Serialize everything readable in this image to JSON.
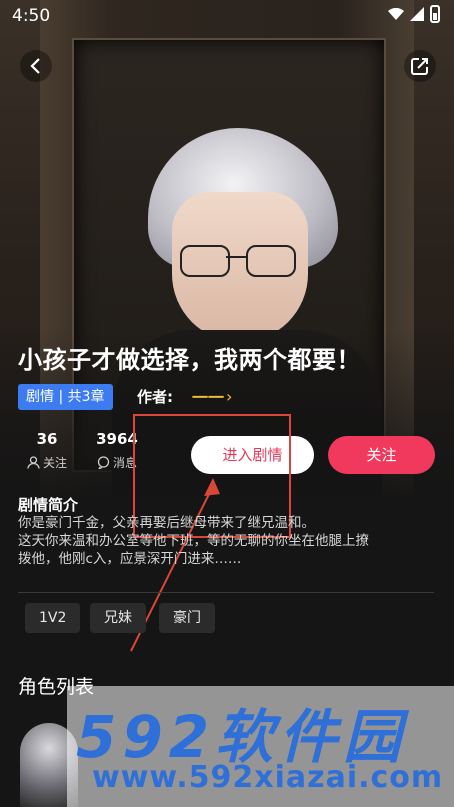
{
  "status_bar": {
    "time": "4:50"
  },
  "novel": {
    "title": "小孩子才做选择，我两个都要！",
    "tag": "剧情 | 共3章",
    "author_label": "作者:",
    "author_name": "一一",
    "author_chevron": "›"
  },
  "stats": [
    {
      "value": "36",
      "label": "关注"
    },
    {
      "value": "3964",
      "label": "消息"
    }
  ],
  "actions": {
    "enter_label": "进入剧情",
    "follow_label": "关注"
  },
  "intro": {
    "title": "剧情简介",
    "lines": [
      "你是豪门千金，父亲再娶后继母带来了继兄温和。",
      "这天你来温和办公室等他下班，等的无聊的你坐在他腿上撩",
      "拨他，他刚c入，应景深开门进来……"
    ]
  },
  "tags": [
    "1V2",
    "兄妹",
    "豪门"
  ],
  "roles": {
    "title": "角色列表"
  },
  "watermark": {
    "text": "592软件园",
    "url": "www.592xiazai.com"
  },
  "colors": {
    "accent_pink": "#f0395c",
    "tag_blue": "#3d7bf0",
    "author_gold": "#f2c13a"
  }
}
